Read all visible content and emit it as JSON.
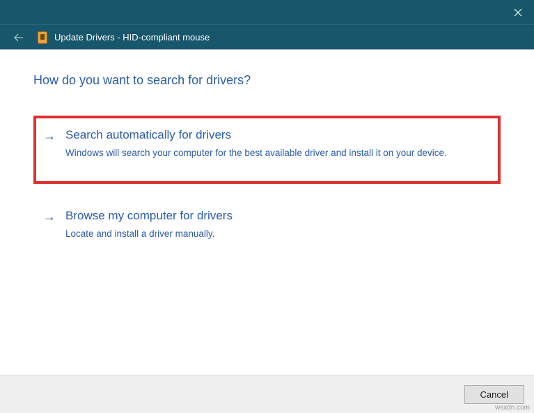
{
  "titlebar": {
    "close_label": "Close"
  },
  "header": {
    "title": "Update Drivers - HID-compliant mouse"
  },
  "content": {
    "heading": "How do you want to search for drivers?",
    "options": [
      {
        "title": "Search automatically for drivers",
        "description": "Windows will search your computer for the best available driver and install it on your device.",
        "highlighted": true
      },
      {
        "title": "Browse my computer for drivers",
        "description": "Locate and install a driver manually.",
        "highlighted": false
      }
    ]
  },
  "footer": {
    "cancel_label": "Cancel"
  },
  "watermark": "wsxdn.com"
}
